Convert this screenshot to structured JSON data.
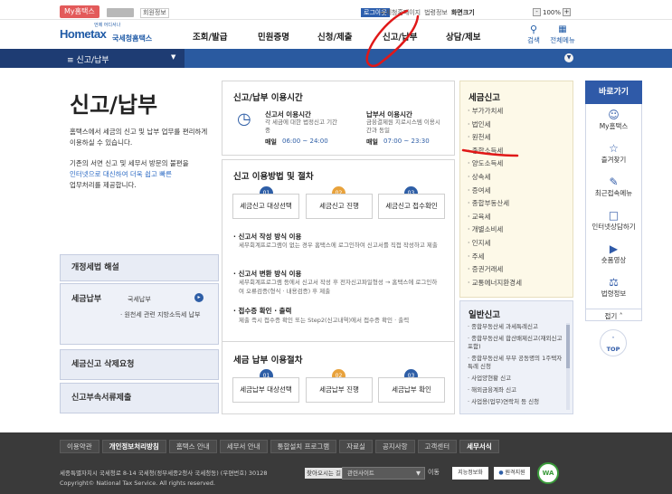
{
  "top": {
    "myhometax_label": "My홈택스",
    "user_info": "회원정보",
    "logout": "로그아웃",
    "links": [
      "국세청홈페이지",
      "법령정보",
      "화면크기"
    ],
    "zoom_minus": "-",
    "zoom_value": "100%",
    "zoom_plus": "+"
  },
  "header": {
    "logo_tagline": "언제 어디서나",
    "logo_text": "Hometax",
    "logo_sub": "국세청홈택스",
    "gnb": [
      "조회/발급",
      "민원증명",
      "신청/제출",
      "신고/납부",
      "상담/제보"
    ],
    "search_label": "검색",
    "allmenu_label": "전체메뉴"
  },
  "subnav": {
    "label": "신고/납부"
  },
  "left": {
    "title": "신고/납부",
    "desc1": "홈택스에서 세금의 신고 및 납부 업무를 편리하게 이용하실 수 있습니다.",
    "desc2_a": "기존의 서면 신고 및 세무서 방문의 불편을",
    "desc2_b": "인터넷으로 대신하여 더욱 쉽고 빠른",
    "desc2_c": "업무처리를 제공합니다.",
    "menus": {
      "m1": "개정세법 해설",
      "m2": "세금납부",
      "m2_sub1": "국세납부",
      "m2_sub2": "· 원천세 관련 지방소득세 납부",
      "m3": "세금신고 삭제요청",
      "m4": "신고부속서류제출"
    }
  },
  "hours": {
    "title": "신고/납부 이용시간",
    "report_title": "신고서 이용시간",
    "report_desc": "각 세금에 대한 법정신고 기간 중",
    "report_time_label": "매일",
    "report_time": "06:00 ~ 24:00",
    "pay_title": "납부서 이용시간",
    "pay_desc": "금융결제원 지로시스템 이용시간과 동일",
    "pay_time_label": "매일",
    "pay_time": "07:00 ~ 23:30"
  },
  "method": {
    "title": "신고 이용방법 및 절차",
    "steps": [
      {
        "num": "01",
        "label": "세금신고 대상선택"
      },
      {
        "num": "02",
        "label": "세금신고 진행"
      },
      {
        "num": "03",
        "label": "세금신고 접수확인"
      }
    ],
    "i1_title": "신고서 작성 방식 이용",
    "i1_desc": "세무회계프로그램이 없는 경우 홈택스에 로그인하여 신고서를 직접 작성하고 제출",
    "i2_title": "신고서 변환 방식 이용",
    "i2_desc": "세무회계프로그램 등에서 신고서 작성 후 전자신고파일형성 → 홈택스에 로그인하여 오류검증(형식 · 내용검증) 후 제출",
    "i3_title": "접수증 확인 · 출력",
    "i3_desc": "제출 즉시 접수증 확인 또는 Step2(신고내역)에서 접수증 확인 · 출력"
  },
  "payflow": {
    "title": "세금 납부 이용절차",
    "steps": [
      {
        "num": "01",
        "label": "세금납부 대상선택"
      },
      {
        "num": "02",
        "label": "세금납부 진행"
      },
      {
        "num": "03",
        "label": "세금납부 확인"
      }
    ]
  },
  "taxreport": {
    "title": "세금신고",
    "items": [
      "부가가치세",
      "법인세",
      "원천세",
      "종합소득세",
      "양도소득세",
      "상속세",
      "증여세",
      "종합부동산세",
      "교육세",
      "개별소비세",
      "인지세",
      "주세",
      "증권거래세",
      "교통에너지환경세"
    ]
  },
  "general": {
    "title": "일반신고",
    "items": [
      "종합부동산세 과세특례신고",
      "종합부동산세 합산배제신고(재외신고 포함)",
      "종합부동산세 부부 공동명의 1주택자 특례 신청",
      "사업양현황 신고",
      "해외금융계좌 신고",
      "사업용(업무)연락처 등 신청"
    ]
  },
  "quick": {
    "head": "바로가기",
    "items": [
      {
        "icon": "person-icon",
        "label": "My홈택스"
      },
      {
        "icon": "star-icon",
        "label": "즐겨찾기"
      },
      {
        "icon": "recent-icon",
        "label": "최근접속메뉴"
      },
      {
        "icon": "consult-icon",
        "label": "인터넷상담하기"
      },
      {
        "icon": "video-icon",
        "label": "숏폼영상"
      },
      {
        "icon": "law-icon",
        "label": "법령정보"
      }
    ],
    "collapse": "접기",
    "top": "TOP"
  },
  "footer": {
    "nav": [
      "이용약관",
      "개인정보처리방침",
      "홈택스 안내",
      "세무서 안내",
      "통합설치 프로그램",
      "자료실",
      "공지사항",
      "고객센터",
      "세무서식"
    ],
    "addr1": "세종특별자치시 국세청로 8-14 국세청(정부세종2청사 국세청동) (우편번호) 30128",
    "addr2": "Copyright© National Tax Service. All rights reserved.",
    "find_route": "찾아오시는 길",
    "related_site": "관련사이트",
    "go": "이동",
    "badge1": "지능정보화",
    "badge2": "원격지원",
    "badge3": "WA"
  },
  "colors": {
    "brand": "#1f5aa6",
    "subbar": "#1e3c73",
    "annotation": "#e01818"
  }
}
